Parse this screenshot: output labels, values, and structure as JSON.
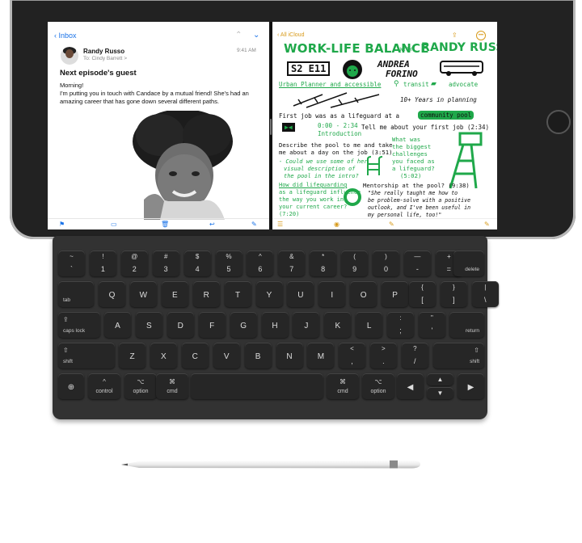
{
  "mail": {
    "nav_back": "Inbox",
    "sender": "Randy Russo",
    "to_line": "To: Cindy Barrett >",
    "time": "9:41 AM",
    "subject": "Next episode's guest",
    "body_line1": "Morning!",
    "body_line2": "I'm putting you in touch with Candace by a mutual friend! She's had an amazing career that has gone down several different paths."
  },
  "notes": {
    "nav_back": "All iCloud",
    "title_line1": "WORK-LIFE BALANCE",
    "title_with": "WITH",
    "title_host": "RANDY RUSSO",
    "episode": "S2 E11",
    "guest_line1": "ANDREA",
    "guest_line2": "FORINO",
    "tag1": "Urban Planner and accessible",
    "tag2": "transit",
    "tag3": "advocate",
    "years": "10+ Years in planning",
    "first_job_a": "First job was as a lifeguard at a",
    "first_job_b": "community pool",
    "timing": "0:00 - 2:34",
    "intro": "Introduction",
    "tell_me": "Tell me about your first job (2:34)",
    "describe1": "Describe the pool to me and take",
    "describe2": "me about a day on the job (3:51)",
    "could1": "- Could we use some of her",
    "could2": "visual description of",
    "could3": "the pool in the intro?",
    "biggest1": "What was",
    "biggest2": "the biggest",
    "biggest3": "challenges",
    "biggest4": "you faced as",
    "biggest5": "a lifeguard?",
    "biggest6": "(5:02)",
    "how1": "How did lifeguarding",
    "how2": "as a lifeguard influence",
    "how3": "the way you work in",
    "how4": "your current career?",
    "how5": "(7:20)",
    "mentor": "Mentorship at the pool? (9:38)",
    "quote1": "\"She really taught me how to",
    "quote2": "be problem-solve with a positive",
    "quote3": "outlook, and I've been useful in",
    "quote4": "my personal life, too!\""
  },
  "keyboard": {
    "row1": [
      {
        "top": "~",
        "bot": "`"
      },
      {
        "top": "!",
        "bot": "1"
      },
      {
        "top": "@",
        "bot": "2"
      },
      {
        "top": "#",
        "bot": "3"
      },
      {
        "top": "$",
        "bot": "4"
      },
      {
        "top": "%",
        "bot": "5"
      },
      {
        "top": "^",
        "bot": "6"
      },
      {
        "top": "&",
        "bot": "7"
      },
      {
        "top": "*",
        "bot": "8"
      },
      {
        "top": "(",
        "bot": "9"
      },
      {
        "top": ")",
        "bot": "0"
      },
      {
        "top": "—",
        "bot": "-"
      },
      {
        "top": "+",
        "bot": "="
      }
    ],
    "delete": "delete",
    "tab": "tab",
    "row2": [
      "Q",
      "W",
      "E",
      "R",
      "T",
      "Y",
      "U",
      "I",
      "O",
      "P"
    ],
    "row2_brackets": [
      {
        "top": "{",
        "bot": "["
      },
      {
        "top": "}",
        "bot": "]"
      },
      {
        "top": "|",
        "bot": "\\"
      }
    ],
    "caps_lock": "caps lock",
    "row3": [
      "A",
      "S",
      "D",
      "F",
      "G",
      "H",
      "J",
      "K",
      "L"
    ],
    "row3_punct": [
      {
        "top": ":",
        "bot": ";"
      },
      {
        "top": "\"",
        "bot": "'"
      }
    ],
    "return": "return",
    "shift": "shift",
    "row4": [
      "Z",
      "X",
      "C",
      "V",
      "B",
      "N",
      "M"
    ],
    "row4_punct": [
      {
        "top": "<",
        "bot": ","
      },
      {
        "top": ">",
        "bot": "."
      },
      {
        "top": "?",
        "bot": "/"
      }
    ],
    "control": "control",
    "option": "option",
    "cmd": "cmd"
  },
  "colors": {
    "accent_mail": "#1a73e8",
    "accent_notes": "#d89b1b",
    "notes_green": "#1fa84a"
  }
}
